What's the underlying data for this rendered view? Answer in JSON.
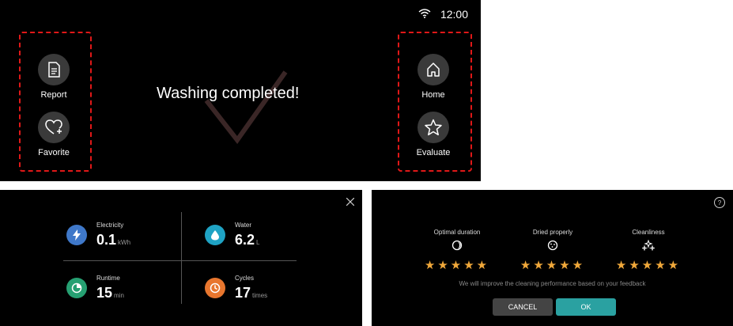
{
  "colors": {
    "accent_teal": "#2aa1a1",
    "star": "#f0a83a",
    "highlight": "#e01818",
    "electricity": "#3f78c9",
    "water": "#1fa3c4",
    "runtime": "#26a072",
    "cycles": "#e8762e"
  },
  "status_bar": {
    "time": "12:00",
    "icon": "wifi-icon"
  },
  "top": {
    "title": "Washing completed!",
    "left_buttons": [
      {
        "label": "Report",
        "icon": "report-icon"
      },
      {
        "label": "Favorite",
        "icon": "favorite-add-icon"
      }
    ],
    "right_buttons": [
      {
        "label": "Home",
        "icon": "home-icon"
      },
      {
        "label": "Evaluate",
        "icon": "star-icon"
      }
    ]
  },
  "energy": {
    "stats": [
      {
        "name": "Electricity",
        "value": "0.1",
        "unit": "kWh",
        "icon": "lightning-icon"
      },
      {
        "name": "Water",
        "value": "6.2",
        "unit": "L",
        "icon": "water-drop-icon"
      },
      {
        "name": "Runtime",
        "value": "15",
        "unit": "min",
        "icon": "timer-icon"
      },
      {
        "name": "Cycles",
        "value": "17",
        "unit": "times",
        "icon": "clock-icon"
      }
    ]
  },
  "rating": {
    "criteria": [
      {
        "label": "Optimal duration",
        "stars": 5,
        "icon": "moon-icon"
      },
      {
        "label": "Dried properly",
        "stars": 5,
        "icon": "dots-circle-icon"
      },
      {
        "label": "Cleanliness",
        "stars": 5,
        "icon": "sparkle-icon"
      }
    ],
    "feedback": "We will improve the cleaning performance based on your feedback",
    "cancel_label": "CANCEL",
    "ok_label": "OK"
  }
}
